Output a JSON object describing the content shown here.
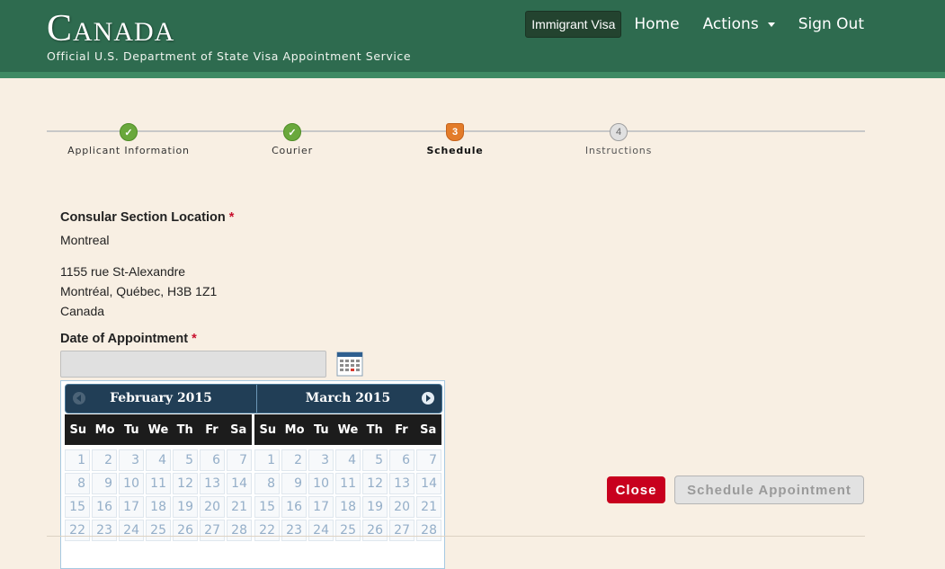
{
  "header": {
    "brand_initial": "C",
    "brand_rest": "ANADA",
    "subtitle": "Official U.S. Department of State Visa Appointment Service",
    "visa_badge": "Immigrant Visa",
    "nav": {
      "home": "Home",
      "actions": "Actions",
      "sign_out": "Sign Out"
    }
  },
  "progress": {
    "steps": [
      {
        "label": "Applicant Information",
        "status": "done"
      },
      {
        "label": "Courier",
        "status": "done"
      },
      {
        "label": "Schedule",
        "number": "3",
        "status": "current"
      },
      {
        "label": "Instructions",
        "number": "4",
        "status": "future"
      }
    ]
  },
  "form": {
    "location_label": "Consular Section Location",
    "required_mark": "*",
    "location_value": "Montreal",
    "address": [
      "1155 rue St-Alexandre",
      "Montréal, Québec, H3B 1Z1",
      "Canada"
    ],
    "date_label": "Date of Appointment",
    "date_value": ""
  },
  "datepicker": {
    "weekdays": [
      "Su",
      "Mo",
      "Tu",
      "We",
      "Th",
      "Fr",
      "Sa"
    ],
    "months": [
      {
        "title": "February 2015",
        "days": [
          1,
          2,
          3,
          4,
          5,
          6,
          7,
          8,
          9,
          10,
          11,
          12,
          13,
          14,
          15,
          16,
          17,
          18,
          19,
          20,
          21,
          22,
          23,
          24,
          25,
          26,
          27,
          28
        ]
      },
      {
        "title": "March 2015",
        "days": [
          1,
          2,
          3,
          4,
          5,
          6,
          7,
          8,
          9,
          10,
          11,
          12,
          13,
          14,
          15,
          16,
          17,
          18,
          19,
          20,
          21,
          22,
          23,
          24,
          25,
          26,
          27,
          28
        ]
      }
    ]
  },
  "buttons": {
    "close": "Close",
    "schedule": "Schedule Appointment"
  },
  "colors": {
    "header_green": "#2e6b4f",
    "background": "#f8efe3",
    "close_red": "#c8001e",
    "done_green": "#6aa83c",
    "current_orange": "#e37c2a"
  }
}
